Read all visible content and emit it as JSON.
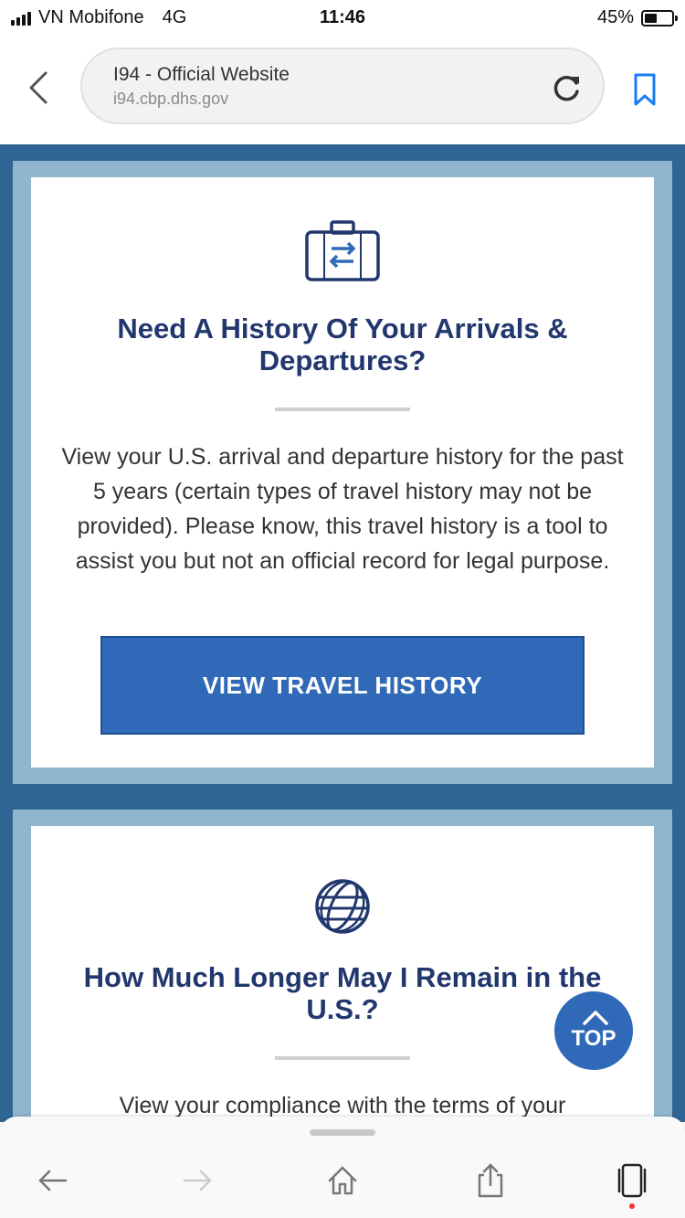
{
  "status_bar": {
    "carrier": "VN Mobifone",
    "network": "4G",
    "time": "11:46",
    "battery": "45%",
    "battery_level": 0.45
  },
  "browser": {
    "page_title": "I94 - Official Website",
    "url": "i94.cbp.dhs.gov"
  },
  "cards": [
    {
      "icon": "briefcase-arrows-icon",
      "heading": "Need A History Of Your Arrivals & Departures?",
      "description": "View your U.S. arrival and departure history for the past 5 years (certain types of travel history may not be provided). Please know, this travel history is a tool to assist you but not an official record for legal purpose.",
      "button_label": "VIEW TRAVEL HISTORY"
    },
    {
      "icon": "globe-icon",
      "heading": "How Much Longer May I Remain in the U.S.?",
      "description": "View your compliance with the terms of your"
    }
  ],
  "back_to_top": "TOP",
  "colors": {
    "page_bg": "#2e6592",
    "frame": "#8fb5cf",
    "heading": "#21376d",
    "button": "#2f69b7",
    "ios_blue": "#1a7cf5"
  }
}
